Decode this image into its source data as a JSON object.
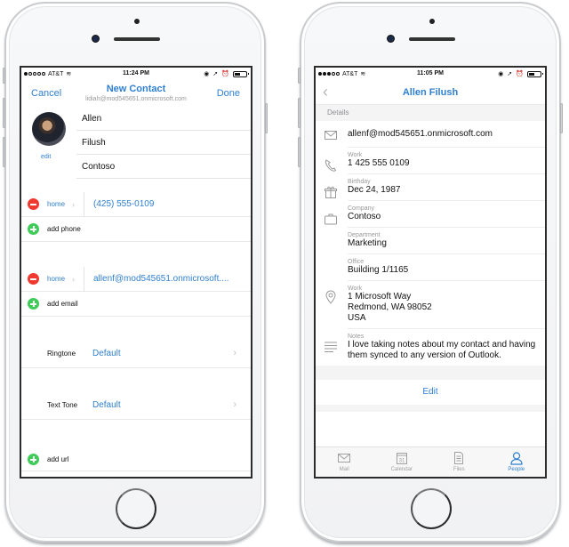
{
  "left_phone": {
    "status": {
      "carrier": "AT&T",
      "time": "11:24 PM"
    },
    "nav": {
      "cancel": "Cancel",
      "title": "New Contact",
      "subtitle": "lidiah@mod545651.onmicrosoft.com",
      "done": "Done"
    },
    "avatar_edit": "edit",
    "name_fields": {
      "first": "Allen",
      "last": "Filush",
      "company": "Contoso"
    },
    "phone": {
      "type": "home",
      "value": "(425) 555-0109",
      "add_label": "add phone"
    },
    "email": {
      "type": "home",
      "value": "allenf@mod545651.onmicrosoft....",
      "add_label": "add email"
    },
    "ringtone": {
      "label": "Ringtone",
      "value": "Default"
    },
    "text_tone": {
      "label": "Text Tone",
      "value": "Default"
    },
    "url": {
      "add_label": "add url"
    },
    "colors": {
      "accent": "#2f7fd2",
      "remove": "#f0392f",
      "add": "#3dcc57"
    }
  },
  "right_phone": {
    "status": {
      "carrier": "AT&T",
      "time": "11:05 PM"
    },
    "nav": {
      "title": "Allen Filush"
    },
    "section_header": "Details",
    "details": {
      "email": {
        "icon": "mail-icon",
        "value": "allenf@mod545651.onmicrosoft.com"
      },
      "phone": {
        "icon": "phone-icon",
        "label": "Work",
        "value": "1 425 555 0109"
      },
      "birthday": {
        "icon": "gift-icon",
        "label": "Birthday",
        "value": "Dec 24, 1987"
      },
      "company": {
        "icon": "briefcase-icon",
        "label": "Company",
        "value": "Contoso"
      },
      "department": {
        "label": "Department",
        "value": "Marketing"
      },
      "office": {
        "label": "Office",
        "value": "Building 1/1165"
      },
      "address": {
        "icon": "location-pin-icon",
        "label": "Work",
        "line1": "1 Microsoft Way",
        "line2": "Redmond, WA 98052",
        "line3": "USA"
      },
      "notes": {
        "icon": "notes-icon",
        "label": "Notes",
        "value": "I love taking notes about my contact and having them synced to any version of Outlook."
      }
    },
    "edit_label": "Edit",
    "tabs": [
      {
        "label": "Mail",
        "icon": "mail-icon",
        "active": false
      },
      {
        "label": "Calendar",
        "icon": "calendar-icon",
        "badge": "31",
        "active": false
      },
      {
        "label": "Files",
        "icon": "files-icon",
        "active": false
      },
      {
        "label": "People",
        "icon": "people-icon",
        "active": true
      }
    ]
  }
}
